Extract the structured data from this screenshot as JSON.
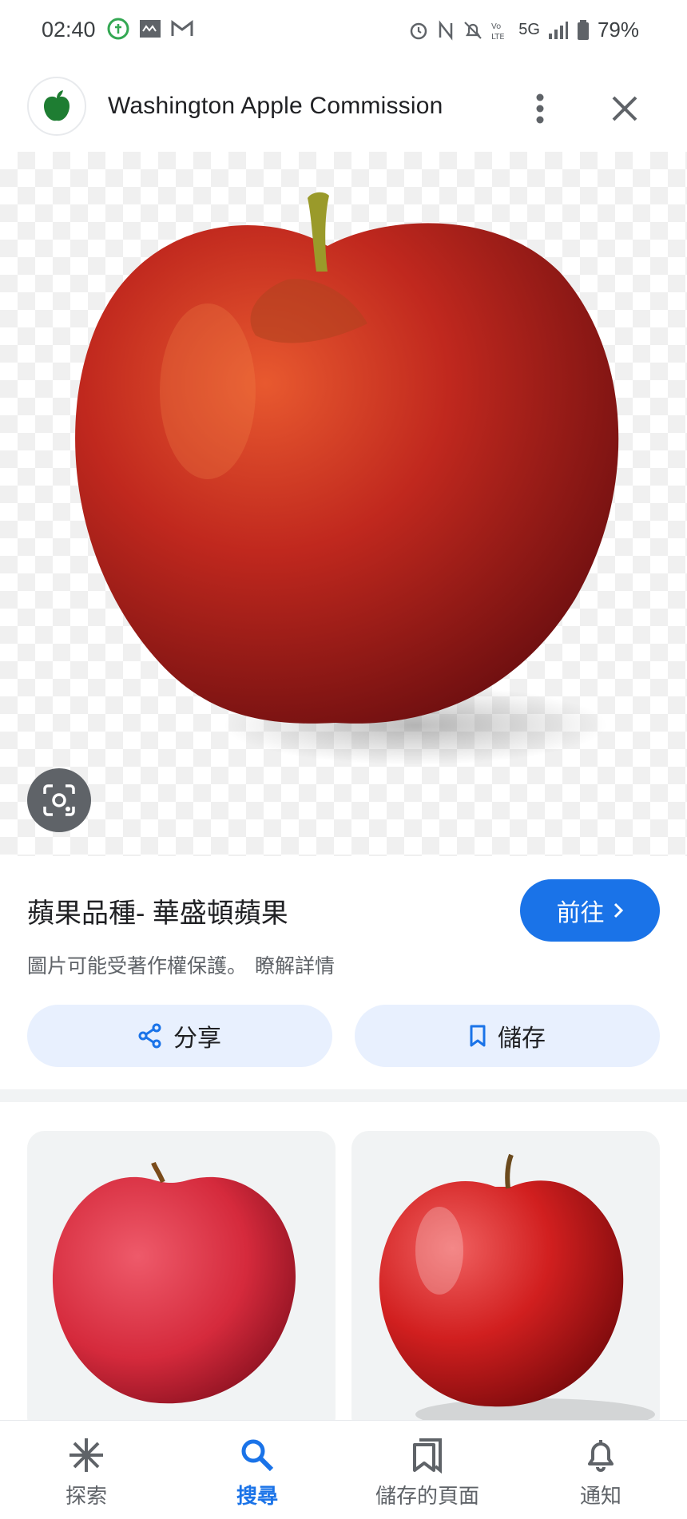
{
  "status_bar": {
    "time": "02:40",
    "battery": "79%",
    "network": "5G"
  },
  "header": {
    "site_name": "Washington Apple Commission",
    "logo_icon": "apple-logo-icon",
    "more_icon": "more-vert-icon",
    "close_icon": "close-icon"
  },
  "image_view": {
    "title": "蘋果品種- 華盛頓蘋果",
    "visit_label": "前往",
    "copyright_notice": "圖片可能受著作權保護。",
    "learn_more": "瞭解詳情",
    "share_label": "分享",
    "save_label": "儲存"
  },
  "bottom_nav": {
    "items": [
      {
        "label": "探索",
        "icon": "asterisk-icon"
      },
      {
        "label": "搜尋",
        "icon": "search-icon"
      },
      {
        "label": "儲存的頁面",
        "icon": "bookmarks-icon"
      },
      {
        "label": "通知",
        "icon": "bell-icon"
      }
    ]
  },
  "colors": {
    "accent": "#1a73e8",
    "tonal_button": "#e8f0fe",
    "apple_red": "#c0281e"
  }
}
